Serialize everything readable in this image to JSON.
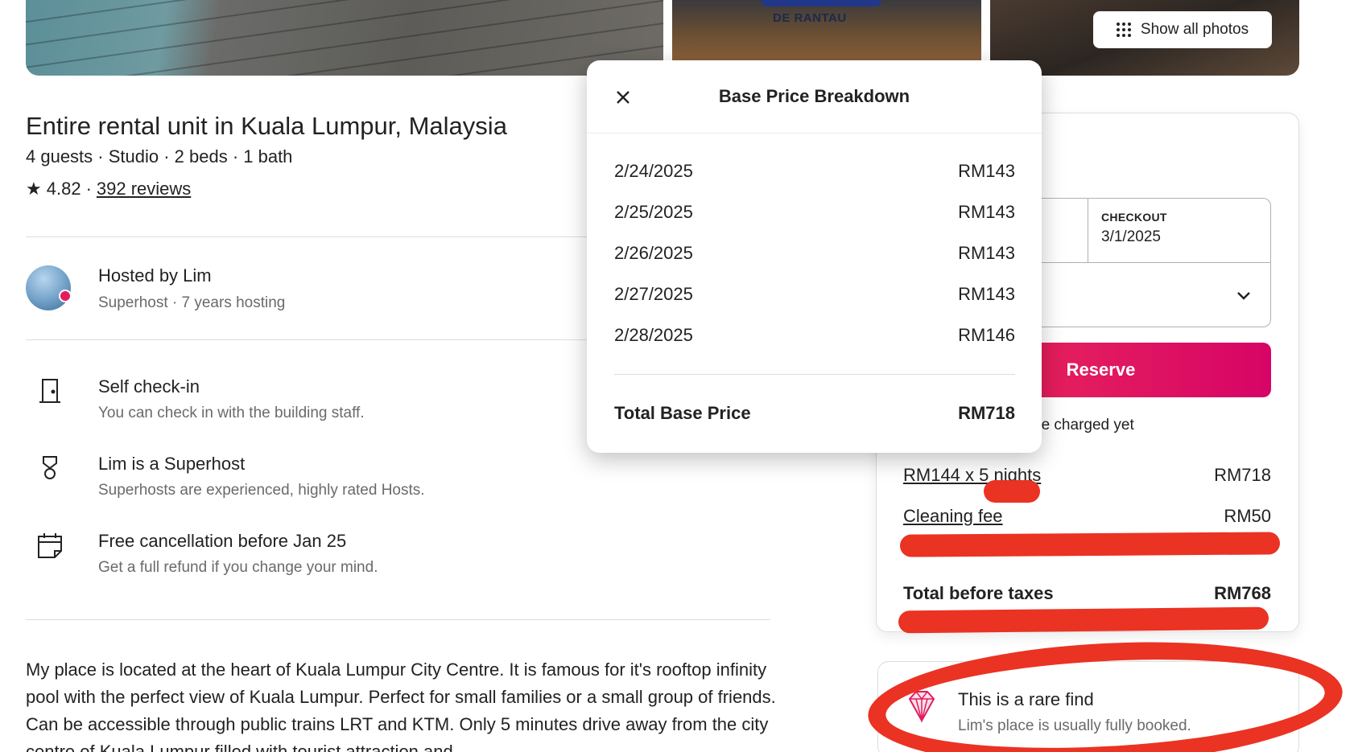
{
  "gallery": {
    "sign_text": "DE RANTAU",
    "show_all_label": "Show all photos"
  },
  "listing": {
    "title": "Entire rental unit in Kuala Lumpur, Malaysia",
    "subtitle": "4 guests · Studio · 2 beds · 1 bath",
    "rating": "4.82",
    "separator": "·",
    "reviews_label": "392 reviews"
  },
  "host": {
    "name": "Hosted by Lim",
    "subtitle": "Superhost · 7 years hosting"
  },
  "features": [
    {
      "icon": "door-icon",
      "title": "Self check-in",
      "desc": "You can check in with the building staff."
    },
    {
      "icon": "superhost-icon",
      "title": "Lim is a Superhost",
      "desc": "Superhosts are experienced, highly rated Hosts."
    },
    {
      "icon": "calendar-icon",
      "title": "Free cancellation before Jan 25",
      "desc": "Get a full refund if you change your mind."
    }
  ],
  "description": "My place is located at the heart of Kuala Lumpur City Centre. It is famous for it's rooftop infinity pool with the perfect view of Kuala Lumpur. Perfect for small families or a small group of friends. Can be accessible through public trains LRT and KTM. Only 5 minutes drive away from the city centre of Kuala Lumpur filled with tourist attraction and",
  "booking": {
    "checkout_label": "CHECKOUT",
    "checkout_value": "3/1/2025",
    "reserve_label": "Reserve",
    "charge_note": "n't be charged yet",
    "nights_label": "RM144 x 5 nights",
    "nights_amount": "RM718",
    "cleaning_label": "Cleaning fee",
    "cleaning_amount": "RM50",
    "total_label": "Total before taxes",
    "total_amount": "RM768"
  },
  "rare_find": {
    "title": "This is a rare find",
    "subtitle": "Lim's place is usually fully booked."
  },
  "modal": {
    "title": "Base Price Breakdown",
    "rows": [
      {
        "date": "2/24/2025",
        "price": "RM143"
      },
      {
        "date": "2/25/2025",
        "price": "RM143"
      },
      {
        "date": "2/26/2025",
        "price": "RM143"
      },
      {
        "date": "2/27/2025",
        "price": "RM143"
      },
      {
        "date": "2/28/2025",
        "price": "RM146"
      }
    ],
    "total_label": "Total Base Price",
    "total_amount": "RM718"
  },
  "colors": {
    "brand": "#e31c5f",
    "annotation": "#ea3323",
    "text": "#222222",
    "muted": "#6a6a6a"
  }
}
